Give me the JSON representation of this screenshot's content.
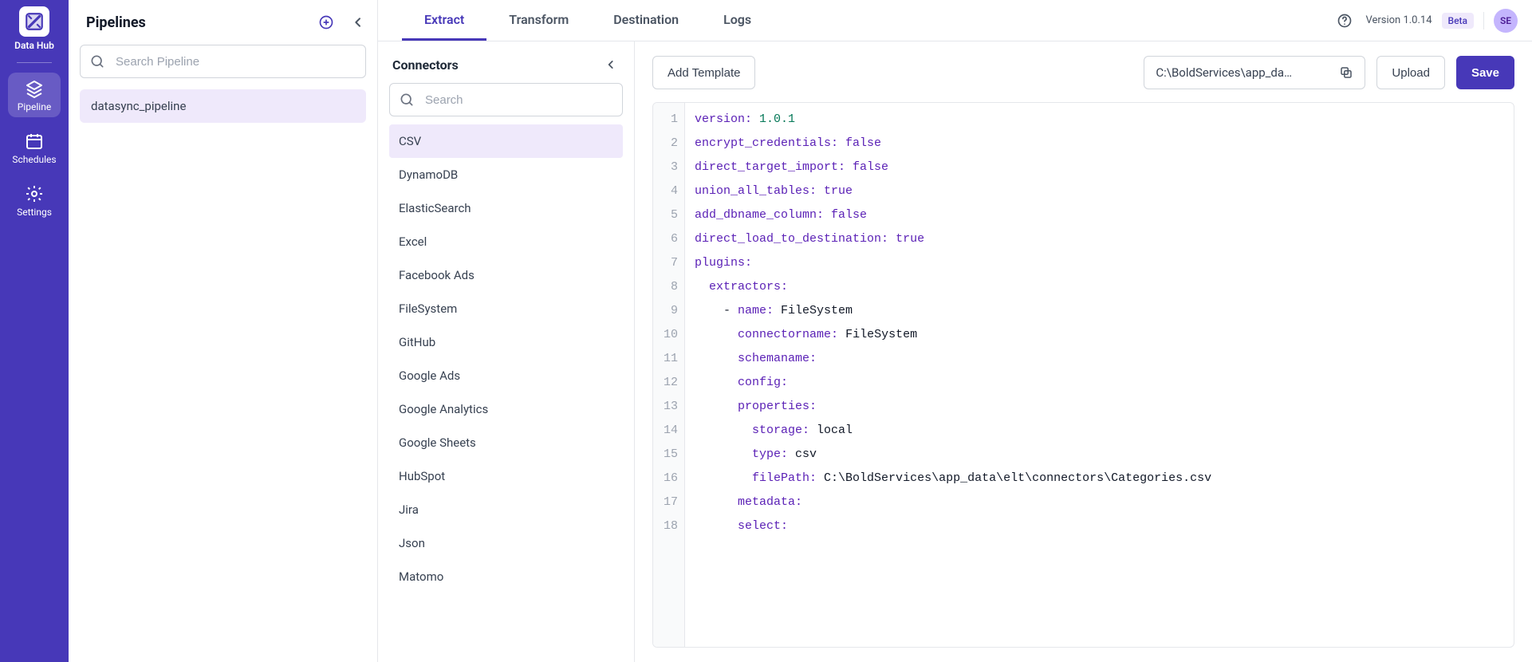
{
  "app": {
    "title": "Data Hub"
  },
  "nav": {
    "items": [
      {
        "label": "Pipeline",
        "active": true
      },
      {
        "label": "Schedules",
        "active": false
      },
      {
        "label": "Settings",
        "active": false
      }
    ]
  },
  "pipelines_panel": {
    "title": "Pipelines",
    "search_placeholder": "Search Pipeline",
    "items": [
      {
        "name": "datasync_pipeline",
        "selected": true
      }
    ]
  },
  "top_tabs": {
    "items": [
      {
        "label": "Extract",
        "active": true
      },
      {
        "label": "Transform",
        "active": false
      },
      {
        "label": "Destination",
        "active": false
      },
      {
        "label": "Logs",
        "active": false
      }
    ]
  },
  "topbar": {
    "version": "Version 1.0.14",
    "badge": "Beta",
    "avatar_initials": "SE"
  },
  "connectors_panel": {
    "title": "Connectors",
    "search_placeholder": "Search",
    "items": [
      "CSV",
      "DynamoDB",
      "ElasticSearch",
      "Excel",
      "Facebook Ads",
      "FileSystem",
      "GitHub",
      "Google Ads",
      "Google Analytics",
      "Google Sheets",
      "HubSpot",
      "Jira",
      "Json",
      "Matomo"
    ],
    "selected": "CSV"
  },
  "toolbar": {
    "add_template_label": "Add Template",
    "upload_label": "Upload",
    "save_label": "Save",
    "file_path_display": "C:\\BoldServices\\app_da…"
  },
  "editor": {
    "lines": [
      [
        [
          "key",
          "version"
        ],
        [
          "punc",
          ": "
        ],
        [
          "num",
          "1.0.1"
        ]
      ],
      [
        [
          "key",
          "encrypt_credentials"
        ],
        [
          "punc",
          ": "
        ],
        [
          "bool",
          "false"
        ]
      ],
      [
        [
          "key",
          "direct_target_import"
        ],
        [
          "punc",
          ": "
        ],
        [
          "bool",
          "false"
        ]
      ],
      [
        [
          "key",
          "union_all_tables"
        ],
        [
          "punc",
          ": "
        ],
        [
          "bool",
          "true"
        ]
      ],
      [
        [
          "key",
          "add_dbname_column"
        ],
        [
          "punc",
          ": "
        ],
        [
          "bool",
          "false"
        ]
      ],
      [
        [
          "key",
          "direct_load_to_destination"
        ],
        [
          "punc",
          ": "
        ],
        [
          "bool",
          "true"
        ]
      ],
      [
        [
          "key",
          "plugins"
        ],
        [
          "punc",
          ":"
        ]
      ],
      [
        [
          "val",
          "  "
        ],
        [
          "key",
          "extractors"
        ],
        [
          "punc",
          ":"
        ]
      ],
      [
        [
          "val",
          "    - "
        ],
        [
          "key",
          "name"
        ],
        [
          "punc",
          ": "
        ],
        [
          "val",
          "FileSystem"
        ]
      ],
      [
        [
          "val",
          "      "
        ],
        [
          "key",
          "connectorname"
        ],
        [
          "punc",
          ": "
        ],
        [
          "val",
          "FileSystem"
        ]
      ],
      [
        [
          "val",
          "      "
        ],
        [
          "key",
          "schemaname"
        ],
        [
          "punc",
          ":"
        ]
      ],
      [
        [
          "val",
          "      "
        ],
        [
          "key",
          "config"
        ],
        [
          "punc",
          ":"
        ]
      ],
      [
        [
          "val",
          "      "
        ],
        [
          "key",
          "properties"
        ],
        [
          "punc",
          ":"
        ]
      ],
      [
        [
          "val",
          "        "
        ],
        [
          "key",
          "storage"
        ],
        [
          "punc",
          ": "
        ],
        [
          "val",
          "local"
        ]
      ],
      [
        [
          "val",
          "        "
        ],
        [
          "key",
          "type"
        ],
        [
          "punc",
          ": "
        ],
        [
          "val",
          "csv"
        ]
      ],
      [
        [
          "val",
          "        "
        ],
        [
          "key",
          "filePath"
        ],
        [
          "punc",
          ": "
        ],
        [
          "val",
          "C:\\BoldServices\\app_data\\elt\\connectors\\Categories.csv"
        ]
      ],
      [
        [
          "val",
          "      "
        ],
        [
          "key",
          "metadata"
        ],
        [
          "punc",
          ":"
        ]
      ],
      [
        [
          "val",
          "      "
        ],
        [
          "key",
          "select"
        ],
        [
          "punc",
          ":"
        ]
      ]
    ]
  }
}
